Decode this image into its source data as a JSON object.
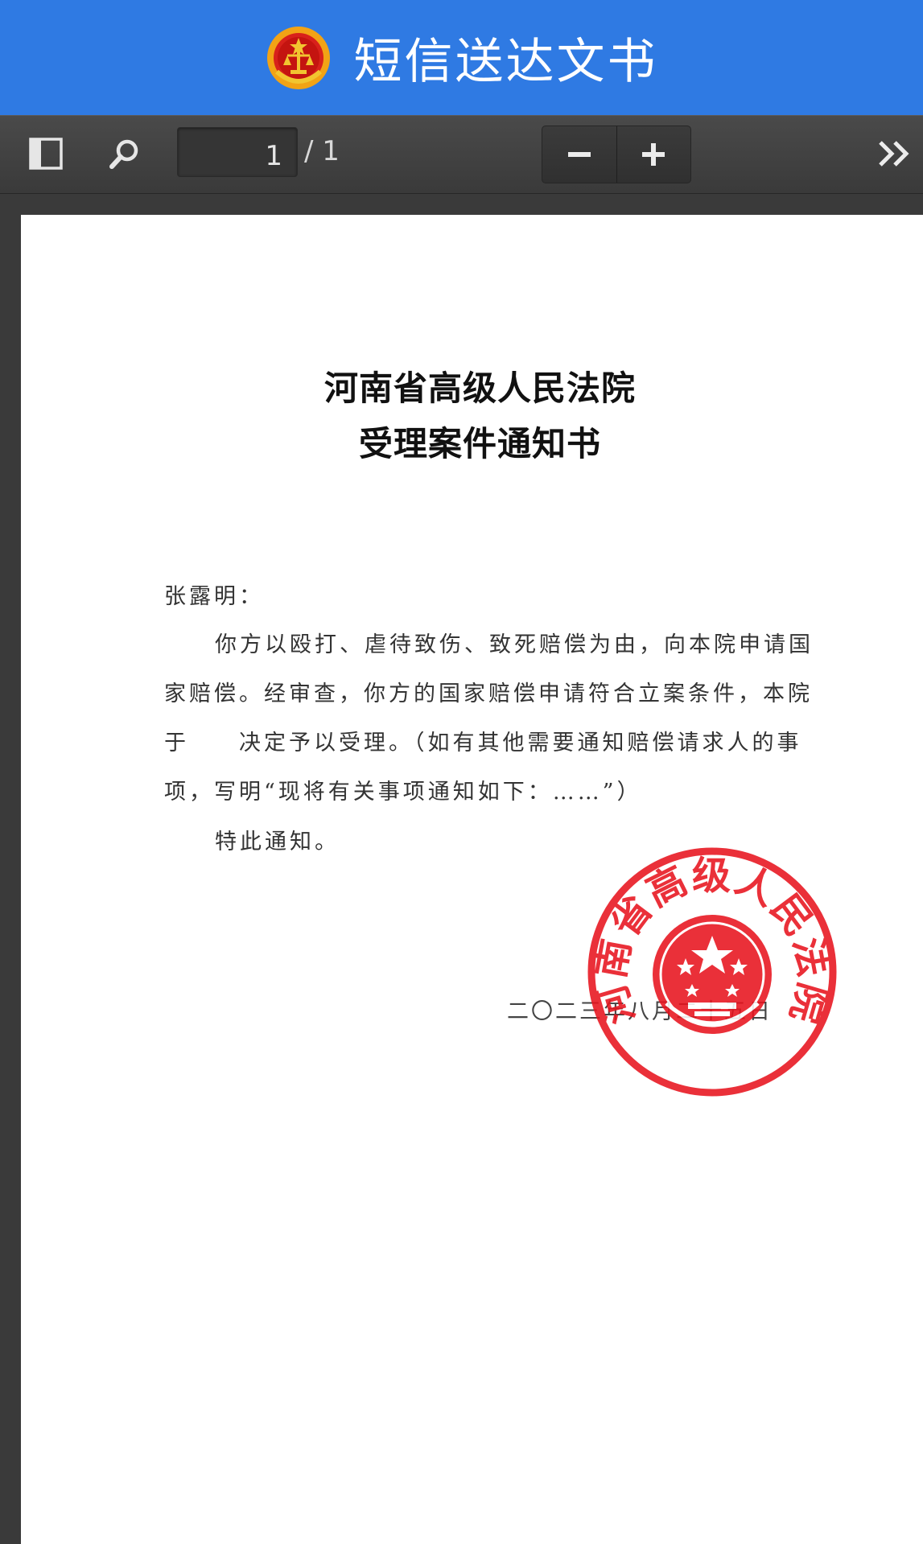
{
  "header": {
    "title": "短信送达文书"
  },
  "toolbar": {
    "page_current": "1",
    "page_total": "/ 1",
    "zoom_out_label": "−",
    "zoom_in_label": "+",
    "icons": [
      "sidebar-toggle-icon",
      "search-icon",
      "double-chevron-right-icon"
    ]
  },
  "document": {
    "title_line1": "河南省高级人民法院",
    "title_line2": "受理案件通知书",
    "addressee": "张露明：",
    "para1_line1": "你方以殴打、虐待致伤、致死赔偿为由，向本院申请国",
    "para1_line2": "家赔偿。经审查，你方的国家赔偿申请符合立案条件，本院",
    "para1_line3": "于　　决定予以受理。（如有其他需要通知赔偿请求人的事",
    "para1_line4": "项，写明“现将有关事项通知如下：……”）",
    "closing": "特此通知。",
    "date": "二〇二三年八月二十五日",
    "seal_text": "河南省高级人民法院"
  },
  "colors": {
    "header_bg": "#2f7ae3",
    "toolbar_bg": "#3f3f3f",
    "seal_red": "#e8141e"
  }
}
